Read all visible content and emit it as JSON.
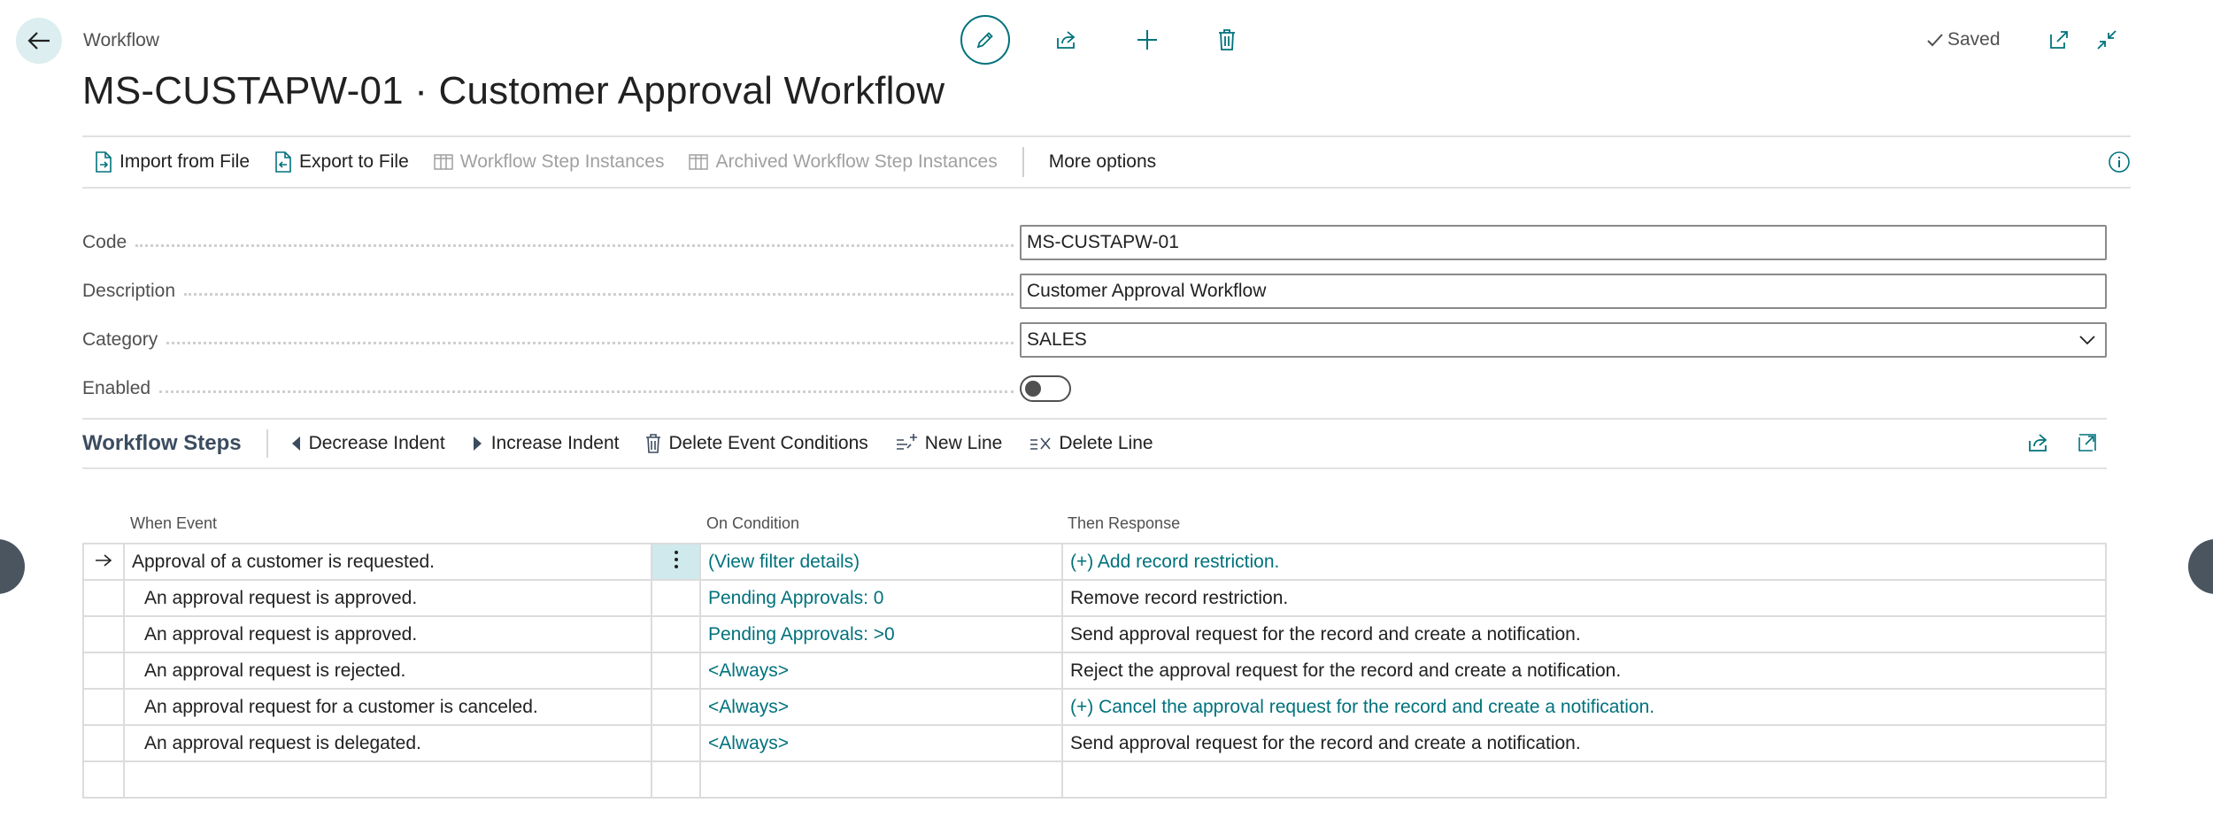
{
  "header": {
    "breadcrumb": "Workflow",
    "title": "MS-CUSTAPW-01 · Customer Approval Workflow",
    "saved_label": "Saved"
  },
  "actions": {
    "import": "Import from File",
    "export": "Export to File",
    "step_instances": "Workflow Step Instances",
    "archived_instances": "Archived Workflow Step Instances",
    "more": "More options"
  },
  "fields": {
    "code": {
      "label": "Code",
      "value": "MS-CUSTAPW-01"
    },
    "description": {
      "label": "Description",
      "value": "Customer Approval Workflow"
    },
    "category": {
      "label": "Category",
      "value": "SALES"
    },
    "enabled": {
      "label": "Enabled",
      "value": false
    }
  },
  "steps": {
    "title": "Workflow Steps",
    "decrease_indent": "Decrease Indent",
    "increase_indent": "Increase Indent",
    "delete_conditions": "Delete Event Conditions",
    "new_line": "New Line",
    "delete_line": "Delete Line",
    "columns": {
      "event": "When Event",
      "condition": "On Condition",
      "response": "Then Response"
    },
    "rows": [
      {
        "event": "Approval of a customer is requested.",
        "condition": "(View filter details)",
        "response": "(+) Add record restriction."
      },
      {
        "event": "An approval request is approved.",
        "condition": "Pending Approvals: 0",
        "response": "Remove record restriction."
      },
      {
        "event": "An approval request is approved.",
        "condition": "Pending Approvals: >0",
        "response": "Send approval request for the record and create a notification."
      },
      {
        "event": "An approval request is rejected.",
        "condition": "<Always>",
        "response": "Reject the approval request for the record and create a notification."
      },
      {
        "event": "An approval request for a customer is canceled.",
        "condition": "<Always>",
        "response": "(+) Cancel the approval request for the record and create a notification."
      },
      {
        "event": "An approval request is delegated.",
        "condition": "<Always>",
        "response": "Send approval request for the record and create a notification."
      },
      {
        "event": "",
        "condition": "",
        "response": ""
      }
    ]
  },
  "colors": {
    "accent": "#00727c",
    "link": "#00727c",
    "selected_cell": "#cfe9ec"
  }
}
